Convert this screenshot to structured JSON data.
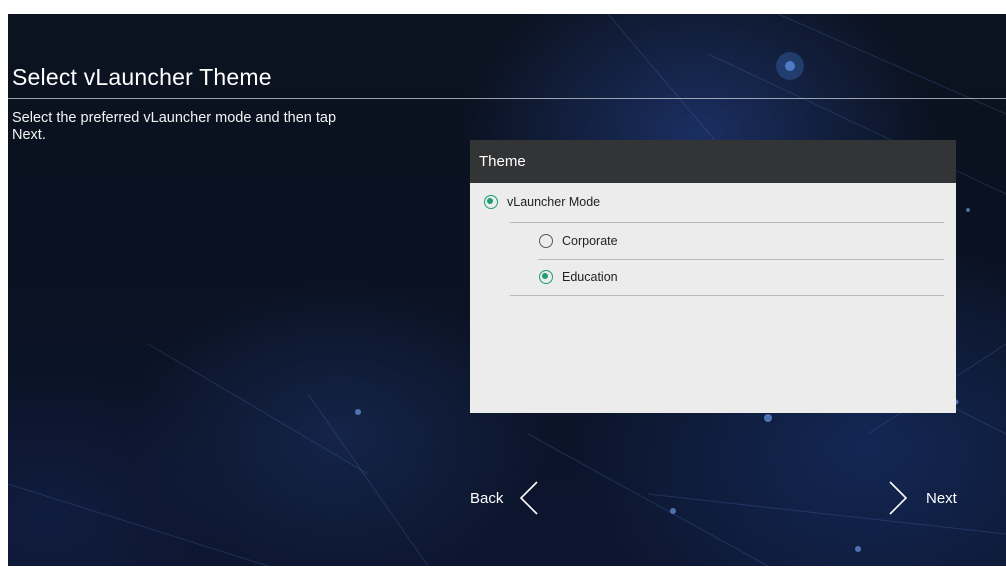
{
  "page": {
    "title": "Select vLauncher Theme",
    "subtitle": "Select the preferred vLauncher mode and then tap Next."
  },
  "theme_panel": {
    "header": "Theme",
    "options": [
      {
        "label": "vLauncher Mode",
        "selected": true
      },
      {
        "label": "Corporate",
        "selected": false
      },
      {
        "label": "Education",
        "selected": true
      }
    ]
  },
  "navigation": {
    "back_label": "Back",
    "back_icon": "chevron-left-icon",
    "next_label": "Next",
    "next_icon": "chevron-right-icon"
  },
  "colors": {
    "accent": "#1e9e74",
    "panel_header": "#333435",
    "panel_body": "#ececec"
  }
}
